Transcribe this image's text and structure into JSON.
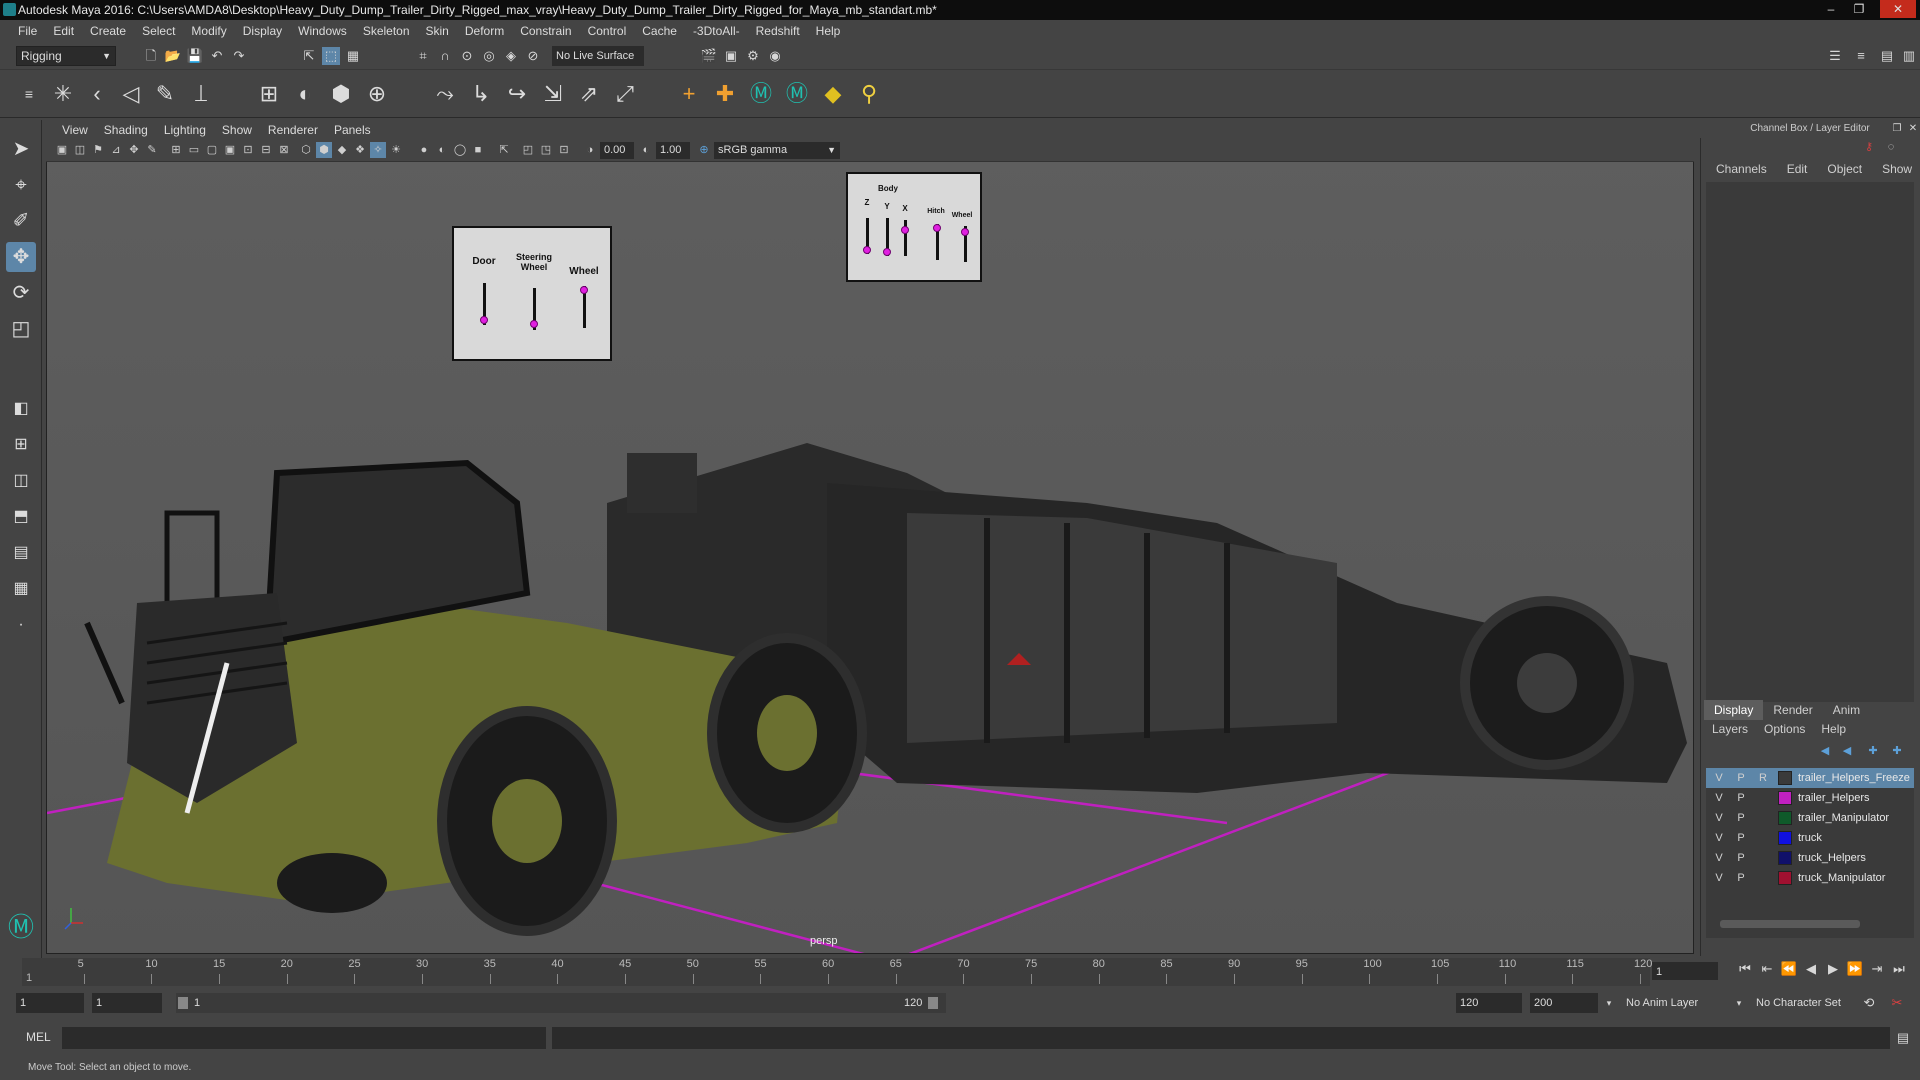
{
  "window": {
    "title": "Autodesk Maya 2016: C:\\Users\\AMDA8\\Desktop\\Heavy_Duty_Dump_Trailer_Dirty_Rigged_max_vray\\Heavy_Duty_Dump_Trailer_Dirty_Rigged_for_Maya_mb_standart.mb*",
    "controls": [
      "–",
      "❐",
      "✕"
    ]
  },
  "menubar": [
    "File",
    "Edit",
    "Create",
    "Select",
    "Modify",
    "Display",
    "Windows",
    "Skeleton",
    "Skin",
    "Deform",
    "Constrain",
    "Control",
    "Cache",
    "-3DtoAll-",
    "Redshift",
    "Help"
  ],
  "statusline": {
    "mode": "Rigging",
    "live_surface": "No Live Surface"
  },
  "viewport": {
    "menu": [
      "View",
      "Shading",
      "Lighting",
      "Show",
      "Renderer",
      "Panels"
    ],
    "exposure": "0.00",
    "gamma": "1.00",
    "color_space": "sRGB gamma",
    "camera_label": "persp"
  },
  "controls_panel_a": {
    "labels": [
      "Door",
      "Steering Wheel",
      "Wheel"
    ]
  },
  "controls_panel_b": {
    "labels": [
      "Z",
      "Body",
      "Y",
      "X",
      "Hitch",
      "Wheel"
    ]
  },
  "right_panel": {
    "title": "Channel Box / Layer Editor",
    "tabs": [
      "Channels",
      "Edit",
      "Object",
      "Show"
    ],
    "display_tabs": [
      "Display",
      "Render",
      "Anim"
    ],
    "layer_menu": [
      "Layers",
      "Options",
      "Help"
    ],
    "layers": [
      {
        "v": "V",
        "p": "P",
        "r": "R",
        "name": "trailer_Helpers_Freeze",
        "color": "#3a3a3a"
      },
      {
        "v": "V",
        "p": "P",
        "r": "",
        "name": "trailer_Helpers",
        "color": "#c020c0"
      },
      {
        "v": "V",
        "p": "P",
        "r": "",
        "name": "trailer_Manipulator",
        "color": "#0f5a2a"
      },
      {
        "v": "V",
        "p": "P",
        "r": "",
        "name": "truck",
        "color": "#1010e0"
      },
      {
        "v": "V",
        "p": "P",
        "r": "",
        "name": "truck_Helpers",
        "color": "#10106a"
      },
      {
        "v": "V",
        "p": "P",
        "r": "",
        "name": "truck_Manipulator",
        "color": "#a01030"
      }
    ]
  },
  "timeline": {
    "ticks": [
      "5",
      "10",
      "15",
      "20",
      "25",
      "30",
      "35",
      "40",
      "45",
      "50",
      "55",
      "60",
      "65",
      "70",
      "75",
      "80",
      "85",
      "90",
      "95",
      "100",
      "105",
      "110",
      "115",
      "120"
    ],
    "start_label": "1",
    "current_frame": "1"
  },
  "range": {
    "start": "1",
    "playback_start": "1",
    "slider_start": "1",
    "slider_end": "120",
    "playback_end": "120",
    "end": "200",
    "anim_layer": "No Anim Layer",
    "character_set": "No Character Set"
  },
  "mel": {
    "label": "MEL"
  },
  "helpline": "Move Tool: Select an object to move."
}
